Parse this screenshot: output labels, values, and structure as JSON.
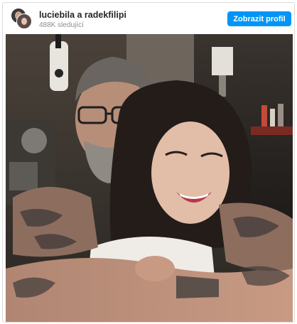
{
  "header": {
    "names": "luciebila a radekfilipi",
    "followers": "488K sledující",
    "profile_button": "Zobrazit profil"
  },
  "colors": {
    "accent": "#0095f6",
    "border": "#dbdbdb",
    "secondary_text": "#8e8e8e"
  },
  "post": {
    "image": "photo-of-smiling-couple-hugging"
  }
}
